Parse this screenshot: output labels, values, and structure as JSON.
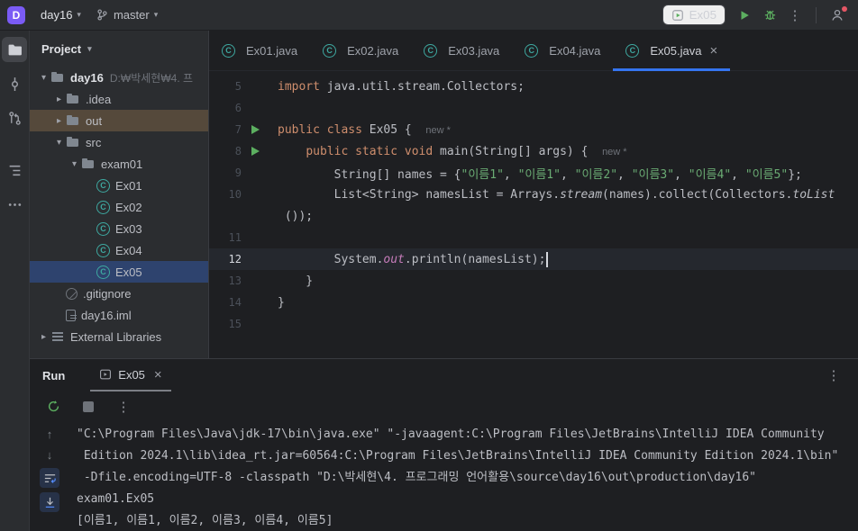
{
  "colors": {
    "accent": "#3574f0",
    "run_green": "#5caf60",
    "selection_blue": "#2e436e",
    "out_highlight": "#55493b",
    "keyword": "#cf8e6d",
    "string": "#6aab73",
    "static_field": "#c77dbb",
    "hint_gray": "#6f737a",
    "badge_purple": "#7a5bf5"
  },
  "titlebar": {
    "app_badge": "D",
    "project": "day16",
    "branch": "master",
    "run_config": "Ex05"
  },
  "tool_stripe": {
    "items": [
      "project-folder",
      "commit",
      "pull-requests",
      "structure",
      "more"
    ]
  },
  "project_panel": {
    "title": "Project",
    "items": [
      {
        "label": "day16",
        "hint": "D:₩박세현₩4. 프",
        "level": 0,
        "icon": "project",
        "chevron": "down",
        "bold": true
      },
      {
        "label": ".idea",
        "level": 1,
        "icon": "folder",
        "chevron": "right"
      },
      {
        "label": "out",
        "level": 1,
        "icon": "folder",
        "chevron": "right",
        "selected": "out"
      },
      {
        "label": "src",
        "level": 1,
        "icon": "folder",
        "chevron": "down"
      },
      {
        "label": "exam01",
        "level": 2,
        "icon": "package",
        "chevron": "down"
      },
      {
        "label": "Ex01",
        "level": 3,
        "icon": "class"
      },
      {
        "label": "Ex02",
        "level": 3,
        "icon": "class"
      },
      {
        "label": "Ex03",
        "level": 3,
        "icon": "class"
      },
      {
        "label": "Ex04",
        "level": 3,
        "icon": "class"
      },
      {
        "label": "Ex05",
        "level": 3,
        "icon": "class",
        "selected": "blue"
      },
      {
        "label": ".gitignore",
        "level": 1,
        "icon": "ignored"
      },
      {
        "label": "day16.iml",
        "level": 1,
        "icon": "iml"
      },
      {
        "label": "External Libraries",
        "level": 0,
        "icon": "libs",
        "chevron": "right"
      }
    ]
  },
  "editor": {
    "tabs": [
      {
        "label": "Ex01.java"
      },
      {
        "label": "Ex02.java"
      },
      {
        "label": "Ex03.java"
      },
      {
        "label": "Ex04.java"
      },
      {
        "label": "Ex05.java",
        "active": true
      }
    ],
    "lines": [
      {
        "num": "5",
        "tokens": [
          [
            "kw",
            "import"
          ],
          [
            "pl",
            " java.util.stream.Collectors;"
          ]
        ]
      },
      {
        "num": "6",
        "tokens": []
      },
      {
        "num": "7",
        "run": true,
        "tokens": [
          [
            "kw",
            "public"
          ],
          [
            "pl",
            " "
          ],
          [
            "kw",
            "class"
          ],
          [
            "pl",
            " Ex05 {  "
          ],
          [
            "hint",
            "new *"
          ]
        ]
      },
      {
        "num": "8",
        "run": true,
        "tokens": [
          [
            "pl",
            "    "
          ],
          [
            "kw",
            "public"
          ],
          [
            "pl",
            " "
          ],
          [
            "kw",
            "static"
          ],
          [
            "pl",
            " "
          ],
          [
            "kw",
            "void"
          ],
          [
            "pl",
            " main(String[] args) {  "
          ],
          [
            "hint",
            "new *"
          ]
        ]
      },
      {
        "num": "9",
        "tokens": [
          [
            "pl",
            "        String[] names = {"
          ],
          [
            "str",
            "\"이름1\""
          ],
          [
            "pl",
            ", "
          ],
          [
            "str",
            "\"이름1\""
          ],
          [
            "pl",
            ", "
          ],
          [
            "str",
            "\"이름2\""
          ],
          [
            "pl",
            ", "
          ],
          [
            "str",
            "\"이름3\""
          ],
          [
            "pl",
            ", "
          ],
          [
            "str",
            "\"이름4\""
          ],
          [
            "pl",
            ", "
          ],
          [
            "str",
            "\"이름5\""
          ],
          [
            "pl",
            "};"
          ]
        ]
      },
      {
        "num": "10",
        "tokens": [
          [
            "pl",
            "        List<String> namesList = Arrays."
          ],
          [
            "sm",
            "stream"
          ],
          [
            "pl",
            "(names).collect(Collectors."
          ],
          [
            "sm",
            "toList"
          ]
        ]
      },
      {
        "num": "",
        "tokens": [
          [
            "pl",
            " ());"
          ]
        ]
      },
      {
        "num": "11",
        "tokens": []
      },
      {
        "num": "12",
        "current": true,
        "caret": true,
        "tokens": [
          [
            "pl",
            "        System."
          ],
          [
            "fld",
            "out"
          ],
          [
            "pl",
            ".println(namesList);"
          ]
        ]
      },
      {
        "num": "13",
        "tokens": [
          [
            "pl",
            "    }"
          ]
        ]
      },
      {
        "num": "14",
        "tokens": [
          [
            "pl",
            "}"
          ]
        ]
      },
      {
        "num": "15",
        "tokens": []
      }
    ]
  },
  "run_panel": {
    "title": "Run",
    "tab_label": "Ex05",
    "console_lines": [
      "\"C:\\Program Files\\Java\\jdk-17\\bin\\java.exe\" \"-javaagent:C:\\Program Files\\JetBrains\\IntelliJ IDEA Community",
      " Edition 2024.1\\lib\\idea_rt.jar=60564:C:\\Program Files\\JetBrains\\IntelliJ IDEA Community Edition 2024.1\\bin\"",
      " -Dfile.encoding=UTF-8 -classpath \"D:\\박세현\\4. 프로그래밍 언어활용\\source\\day16\\out\\production\\day16\"",
      "exam01.Ex05",
      "[이름1, 이름1, 이름2, 이름3, 이름4, 이름5]"
    ]
  }
}
